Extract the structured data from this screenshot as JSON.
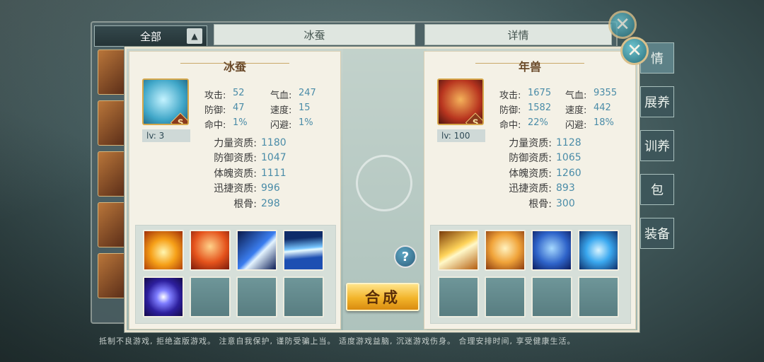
{
  "background": {
    "filter_label": "全部",
    "center_tab_label": "冰蚕",
    "right_tab_label": "详情",
    "side_tabs": [
      "情",
      "展养",
      "训养",
      "包",
      "装备"
    ]
  },
  "left_pet": {
    "name": "冰蚕",
    "grade": "S",
    "level": "lv: 3",
    "stats": [
      {
        "k1": "攻击:",
        "v1": "52",
        "k2": "气血:",
        "v2": "247"
      },
      {
        "k1": "防御:",
        "v1": "47",
        "k2": "速度:",
        "v2": "15"
      },
      {
        "k1": "命中:",
        "v1": "1%",
        "k2": "闪避:",
        "v2": "1%"
      }
    ],
    "aptitudes": [
      {
        "k": "力量资质:",
        "v": "1180"
      },
      {
        "k": "防御资质:",
        "v": "1047"
      },
      {
        "k": "体魄资质:",
        "v": "1111"
      },
      {
        "k": "迅捷资质:",
        "v": "996"
      },
      {
        "k": "根骨:",
        "v": "298"
      }
    ],
    "skills": [
      "fire-burst-icon",
      "flame-beast-icon",
      "ice-claw-icon",
      "blue-streak-icon",
      "purple-orb-icon",
      "empty",
      "empty",
      "empty"
    ]
  },
  "right_pet": {
    "name": "年兽",
    "grade": "S",
    "level": "lv: 100",
    "stats": [
      {
        "k1": "攻击:",
        "v1": "1675",
        "k2": "气血:",
        "v2": "9355"
      },
      {
        "k1": "防御:",
        "v1": "1582",
        "k2": "速度:",
        "v2": "442"
      },
      {
        "k1": "命中:",
        "v1": "22%",
        "k2": "闪避:",
        "v2": "18%"
      }
    ],
    "aptitudes": [
      {
        "k": "力量资质:",
        "v": "1128"
      },
      {
        "k": "防御资质:",
        "v": "1065"
      },
      {
        "k": "体魄资质:",
        "v": "1260"
      },
      {
        "k": "迅捷资质:",
        "v": "893"
      },
      {
        "k": "根骨:",
        "v": "300"
      }
    ],
    "skills": [
      "golden-beam-icon",
      "golden-lion-icon",
      "blue-shield-icon",
      "blue-heart-icon",
      "empty",
      "empty",
      "empty",
      "empty"
    ]
  },
  "actions": {
    "help_label": "?",
    "synthesize_label": "合成",
    "close_label": "✕"
  },
  "footer_text": "抵制不良游戏, 拒绝盗版游戏。 注意自我保护, 谨防受骗上当。 适度游戏益脑, 沉迷游戏伤身。 合理安排时间, 享受健康生活。"
}
